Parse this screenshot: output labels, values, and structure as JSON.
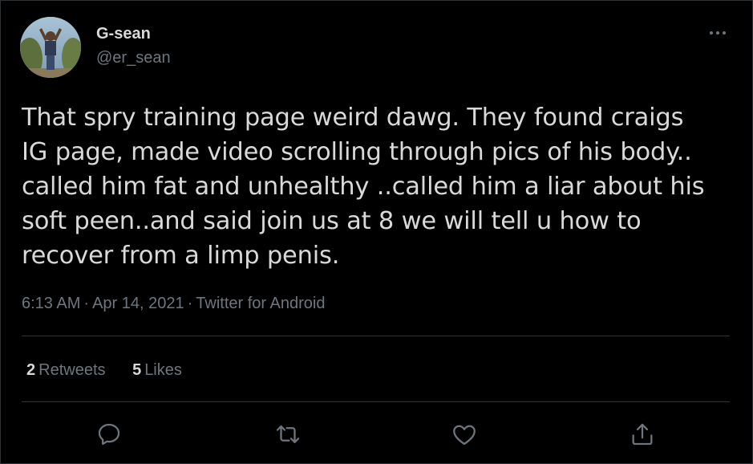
{
  "author": {
    "name": "G-sean",
    "handle": "@er_sean",
    "avatar_icon": "profile-photo"
  },
  "tweet": {
    "text": "That spry training page weird dawg. They found craigs\nIG page, made video scrolling through pics of his body..\ncalled him fat and unhealthy ..called him a liar about his\nsoft peen..and said join us at 8  we will tell u how  to\nrecover from a limp penis.",
    "time": "6:13 AM",
    "date": "Apr 14, 2021",
    "source": "Twitter for Android",
    "separator": "·"
  },
  "stats": {
    "retweets_count": "2",
    "retweets_label": "Retweets",
    "likes_count": "5",
    "likes_label": "Likes"
  },
  "actions": [
    {
      "name": "reply",
      "icon": "reply-icon"
    },
    {
      "name": "retweet",
      "icon": "retweet-icon"
    },
    {
      "name": "like",
      "icon": "heart-icon"
    },
    {
      "name": "share",
      "icon": "share-icon"
    }
  ],
  "colors": {
    "background": "#000000",
    "primary_text": "#d9d9d9",
    "secondary_text": "#6e767d",
    "border": "#2f3336"
  }
}
